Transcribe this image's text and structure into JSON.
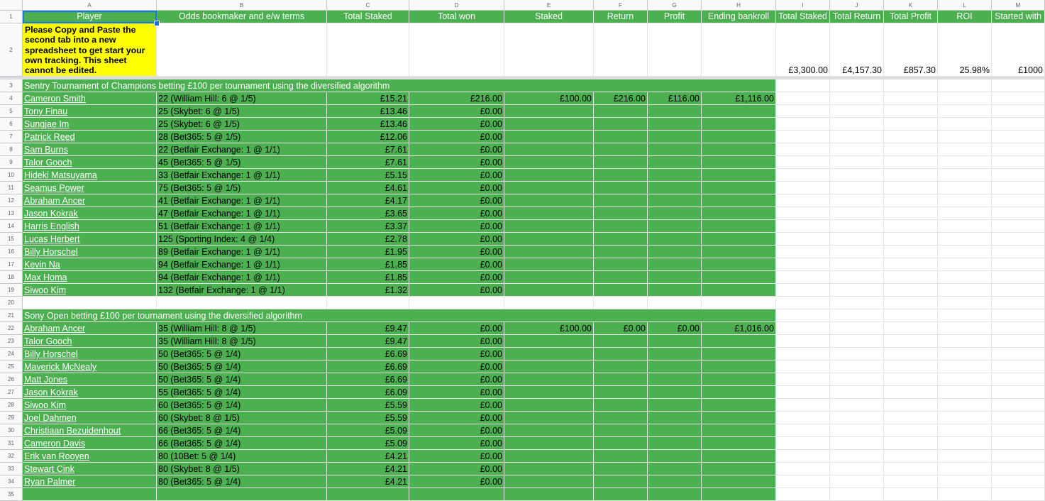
{
  "columns": [
    "A",
    "B",
    "C",
    "D",
    "E",
    "F",
    "G",
    "H",
    "I",
    "J",
    "K",
    "L",
    "M"
  ],
  "header": {
    "player": "Player",
    "odds": "Odds bookmaker and e/w terms",
    "total_staked": "Total Staked",
    "total_won": "Total won",
    "staked": "Staked",
    "return": "Return",
    "profit": "Profit",
    "ending_bankroll": "Ending bankroll",
    "sum_total_staked": "Total Staked",
    "sum_total_return": "Total Return",
    "sum_total_profit": "Total Profit",
    "roi": "ROI",
    "started_with": "Started with"
  },
  "note": "Please Copy and Paste the second tab into a new spreadsheet to get start your own tracking. This sheet cannot be edited.",
  "summary": {
    "total_staked": "£3,300.00",
    "total_return": "£4,157.30",
    "total_profit": "£857.30",
    "roi": "25.98%",
    "started_with": "£1000"
  },
  "sections": [
    {
      "title": "Sentry Tournament of Champions betting £100 per tournament using the diversified algorithm",
      "staked": "£100.00",
      "return": "£216.00",
      "profit": "£116.00",
      "ending_bankroll": "£1,116.00",
      "rows": [
        {
          "player": "Cameron Smith",
          "odds": "22 (William Hill: 6 @ 1/5)",
          "staked": "£15.21",
          "won": "£216.00"
        },
        {
          "player": "Tony Finau",
          "odds": "25 (Skybet: 6 @ 1/5)",
          "staked": "£13.46",
          "won": "£0.00"
        },
        {
          "player": "Sungjae Im",
          "odds": "25 (Skybet: 6 @ 1/5)",
          "staked": "£13.46",
          "won": "£0.00"
        },
        {
          "player": "Patrick Reed",
          "odds": "28 (Bet365: 5 @ 1/5)",
          "staked": "£12.06",
          "won": "£0.00"
        },
        {
          "player": "Sam Burns",
          "odds": "22 (Betfair Exchange: 1 @ 1/1)",
          "staked": "£7.61",
          "won": "£0.00"
        },
        {
          "player": "Talor Gooch",
          "odds": "45 (Bet365: 5 @ 1/5)",
          "staked": "£7.61",
          "won": "£0.00"
        },
        {
          "player": "Hideki Matsuyama",
          "odds": "33 (Betfair Exchange: 1 @ 1/1)",
          "staked": "£5.15",
          "won": "£0.00"
        },
        {
          "player": "Seamus Power",
          "odds": "75 (Bet365: 5 @ 1/5)",
          "staked": "£4.61",
          "won": "£0.00"
        },
        {
          "player": "Abraham Ancer",
          "odds": "41 (Betfair Exchange: 1 @ 1/1)",
          "staked": "£4.17",
          "won": "£0.00"
        },
        {
          "player": "Jason Kokrak",
          "odds": "47 (Betfair Exchange: 1 @ 1/1)",
          "staked": "£3.65",
          "won": "£0.00"
        },
        {
          "player": "Harris English",
          "odds": "51 (Betfair Exchange: 1 @ 1/1)",
          "staked": "£3.37",
          "won": "£0.00"
        },
        {
          "player": "Lucas Herbert",
          "odds": "125 (Sporting Index: 4 @ 1/4)",
          "staked": "£2.78",
          "won": "£0.00"
        },
        {
          "player": "Billy Horschel",
          "odds": "89 (Betfair Exchange: 1 @ 1/1)",
          "staked": "£1.95",
          "won": "£0.00"
        },
        {
          "player": "Kevin Na",
          "odds": "94 (Betfair Exchange: 1 @ 1/1)",
          "staked": "£1.85",
          "won": "£0.00"
        },
        {
          "player": "Max Homa",
          "odds": "94 (Betfair Exchange: 1 @ 1/1)",
          "staked": "£1.85",
          "won": "£0.00"
        },
        {
          "player": "Siwoo Kim",
          "odds": "132 (Betfair Exchange: 1 @ 1/1)",
          "staked": "£1.32",
          "won": "£0.00"
        }
      ]
    },
    {
      "title": "Sony Open betting £100 per tournament using the diversified algorithm",
      "staked": "£100.00",
      "return": "£0.00",
      "profit": "£0.00",
      "ending_bankroll": "£1,016.00",
      "rows": [
        {
          "player": "Abraham Ancer",
          "odds": "35 (William Hill: 8 @ 1/5)",
          "staked": "£9.47",
          "won": "£0.00"
        },
        {
          "player": "Talor Gooch",
          "odds": "35 (William Hill: 8 @ 1/5)",
          "staked": "£9.47",
          "won": "£0.00"
        },
        {
          "player": "Billy Horschel",
          "odds": "50 (Bet365: 5 @ 1/4)",
          "staked": "£6.69",
          "won": "£0.00"
        },
        {
          "player": "Maverick McNealy",
          "odds": "50 (Bet365: 5 @ 1/4)",
          "staked": "£6.69",
          "won": "£0.00"
        },
        {
          "player": "Matt Jones",
          "odds": "50 (Bet365: 5 @ 1/4)",
          "staked": "£6.69",
          "won": "£0.00"
        },
        {
          "player": "Jason Kokrak",
          "odds": "55 (Bet365: 5 @ 1/4)",
          "staked": "£6.09",
          "won": "£0.00"
        },
        {
          "player": "Siwoo Kim",
          "odds": "60 (Bet365: 5 @ 1/4)",
          "staked": "£5.59",
          "won": "£0.00"
        },
        {
          "player": "Joel Dahmen",
          "odds": "60 (Skybet: 8 @ 1/5)",
          "staked": "£5.59",
          "won": "£0.00"
        },
        {
          "player": "Christiaan Bezuidenhout",
          "odds": "66 (Bet365: 5 @ 1/4)",
          "staked": "£5.09",
          "won": "£0.00"
        },
        {
          "player": "Cameron Davis",
          "odds": "66 (Bet365: 5 @ 1/4)",
          "staked": "£5.09",
          "won": "£0.00"
        },
        {
          "player": "Erik van Rooyen",
          "odds": "80 (10Bet: 5 @ 1/4)",
          "staked": "£4.21",
          "won": "£0.00"
        },
        {
          "player": "Stewart Cink",
          "odds": "80 (Skybet: 8 @ 1/5)",
          "staked": "£4.21",
          "won": "£0.00"
        },
        {
          "player": "Ryan Palmer",
          "odds": "80 (Bet365: 5 @ 1/4)",
          "staked": "£4.21",
          "won": "£0.00"
        }
      ]
    }
  ]
}
